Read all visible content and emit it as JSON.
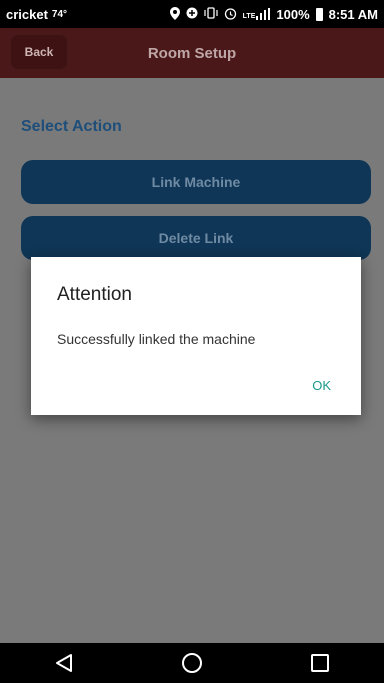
{
  "status_bar": {
    "carrier": "cricket",
    "temperature": "74°",
    "network": "LTE",
    "battery": "100%",
    "time": "8:51 AM"
  },
  "app_bar": {
    "back_label": "Back",
    "title": "Room Setup"
  },
  "main": {
    "section_title": "Select Action",
    "link_machine_label": "Link Machine",
    "delete_link_label": "Delete Link"
  },
  "dialog": {
    "title": "Attention",
    "message": "Successfully linked the machine",
    "ok_label": "OK"
  },
  "nav_bar": {
    "back_icon": "back-triangle-icon",
    "home_icon": "home-circle-icon",
    "recents_icon": "recents-square-icon"
  },
  "colors": {
    "app_bar": "#4a1818",
    "primary_button": "#0f3656",
    "section_title": "#1e4e7a",
    "dialog_action": "#1a9a8a"
  }
}
